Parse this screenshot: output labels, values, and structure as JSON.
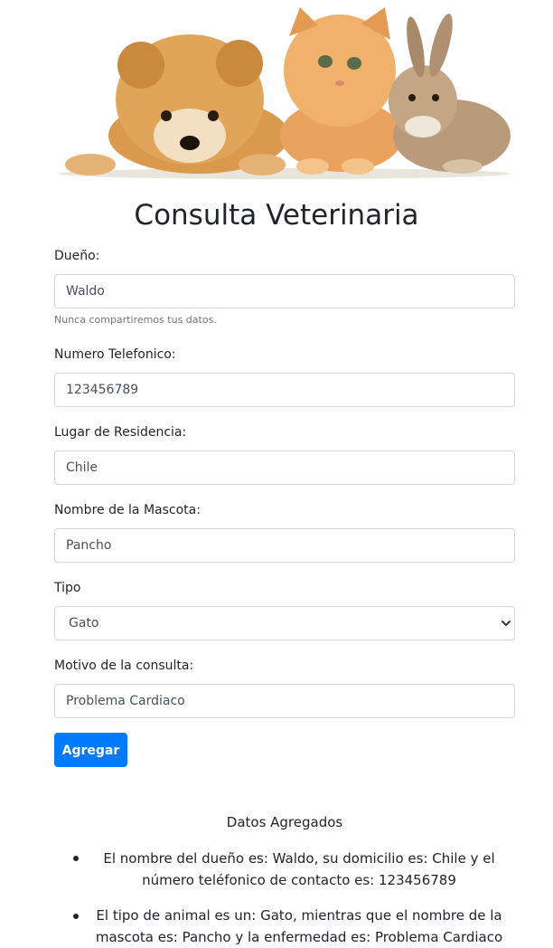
{
  "page": {
    "title": "Consulta Veterinaria"
  },
  "hero": {
    "animals": [
      "puppy",
      "kitten",
      "rabbit"
    ]
  },
  "form": {
    "owner": {
      "label": "Dueño:",
      "value": "Waldo",
      "help": "Nunca compartiremos tus datos."
    },
    "phone": {
      "label": "Numero Telefonico:",
      "value": "123456789"
    },
    "residence": {
      "label": "Lugar de Residencia:",
      "value": "Chile"
    },
    "pet_name": {
      "label": "Nombre de la Mascota:",
      "value": "Pancho"
    },
    "type": {
      "label": "Tipo",
      "selected": "Gato",
      "icon": "chevron-down-icon"
    },
    "reason": {
      "label": "Motivo de la consulta:",
      "value": "Problema Cardiaco"
    },
    "submit_label": "Agregar"
  },
  "results": {
    "title": "Datos Agregados",
    "items": [
      "El nombre del dueño es: Waldo, su domicilio es: Chile y el número teléfonico de contacto es: 123456789",
      "El tipo de animal es un: Gato, mientras que el nombre de la mascota es: Pancho y la enfermedad es: Problema Cardiaco"
    ]
  },
  "colors": {
    "primary": "#007bff",
    "text": "#212529",
    "border": "#ced4da",
    "muted": "#6c757d"
  }
}
